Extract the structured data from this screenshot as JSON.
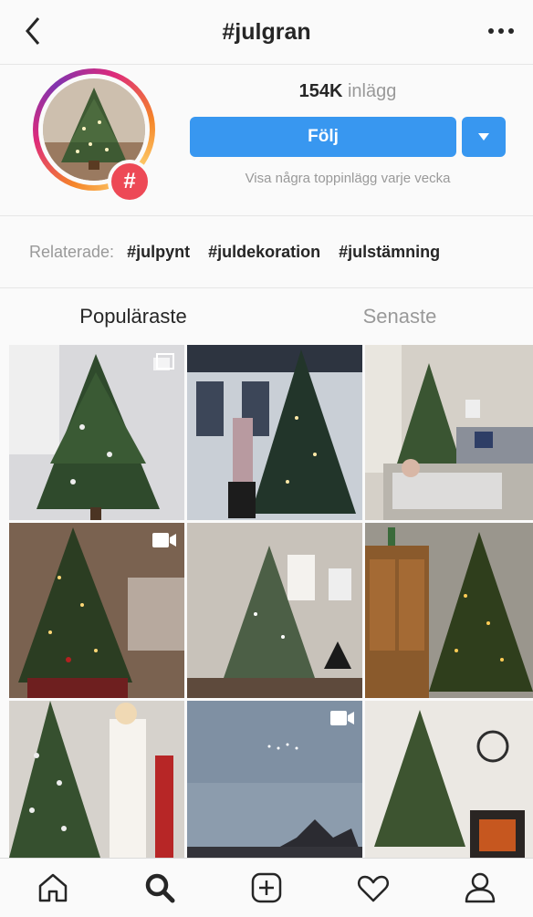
{
  "header": {
    "title": "#julgran",
    "back_icon": "chevron-left-icon",
    "more_icon": "more-horizontal-icon"
  },
  "profile": {
    "posts_count": "154K",
    "posts_label": "inlägg",
    "follow_label": "Följ",
    "subtext": "Visa några toppinlägg varje vecka",
    "badge_symbol": "#"
  },
  "related": {
    "label": "Relaterade:",
    "tags": [
      "#julpynt",
      "#juldekoration",
      "#julstämning"
    ]
  },
  "tabs": [
    {
      "label": "Populäraste",
      "active": true
    },
    {
      "label": "Senaste",
      "active": false
    }
  ],
  "grid": {
    "items": [
      {
        "type": "photo",
        "badge": "multiple"
      },
      {
        "type": "photo",
        "badge": ""
      },
      {
        "type": "photo",
        "badge": ""
      },
      {
        "type": "photo",
        "badge": "video"
      },
      {
        "type": "photo",
        "badge": ""
      },
      {
        "type": "photo",
        "badge": ""
      },
      {
        "type": "photo",
        "badge": ""
      },
      {
        "type": "video",
        "badge": "video"
      },
      {
        "type": "photo",
        "badge": ""
      }
    ]
  },
  "bottom_nav": [
    "home-icon",
    "search-icon",
    "add-post-icon",
    "heart-icon",
    "profile-icon"
  ],
  "colors": {
    "accent": "#3897f0",
    "badge": "#ed4956",
    "muted": "#999999",
    "text": "#262626"
  }
}
